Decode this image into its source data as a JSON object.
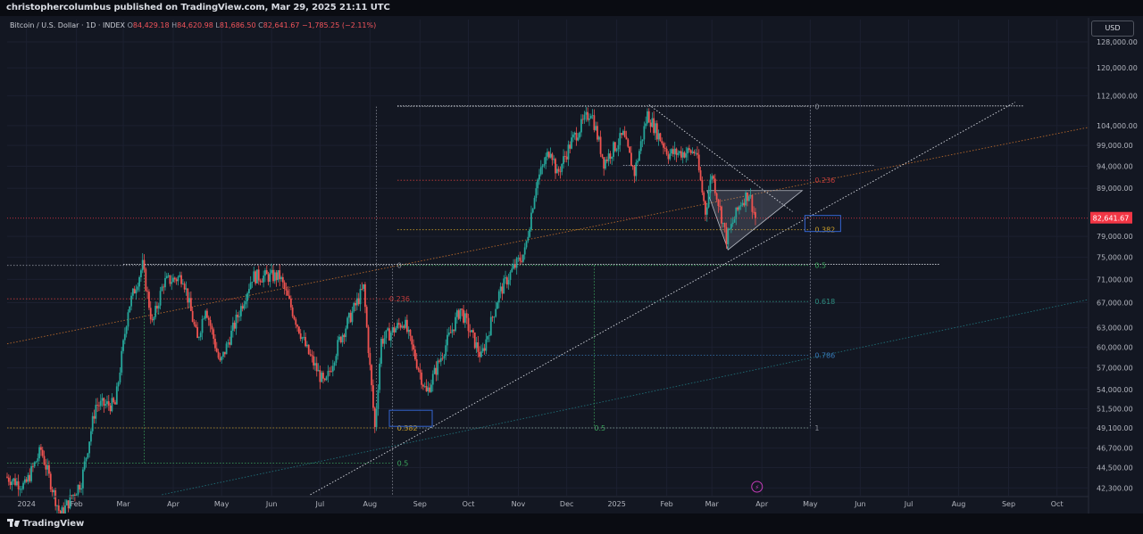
{
  "header": {
    "published": "christophercolumbus published on TradingView.com, Mar 29, 2025 21:11 UTC"
  },
  "legend": {
    "symbol": "Bitcoin / U.S. Dollar · 1D · INDEX",
    "o_label": "O",
    "o_value": "84,429.18",
    "h_label": "H",
    "h_value": "84,620.98",
    "l_label": "L",
    "l_value": "81,686.50",
    "c_label": "C",
    "c_value": "82,641.67",
    "change": "−1,785.25 (−2.11%)"
  },
  "currency_button": "USD",
  "current_price_label": "82,641.67",
  "footer": {
    "brand": "TradingView"
  },
  "colors": {
    "background": "#131722",
    "up": "#26a69a",
    "down": "#ef5350",
    "price_tag": "#f23645"
  },
  "chart_data": {
    "type": "candlestick",
    "title": "",
    "y_scale": "log",
    "ylim": [
      41500,
      130000
    ],
    "y_ticks": [
      128000,
      120000,
      112000,
      104000,
      99000,
      94000,
      89000,
      79000,
      75000,
      71000,
      67000,
      63000,
      60000,
      57000,
      54000,
      51500,
      49100,
      46700,
      44500,
      42300
    ],
    "y_tick_labels": [
      "128,000.00",
      "120,000.00",
      "112,000.00",
      "104,000.00",
      "99,000.00",
      "94,000.00",
      "89,000.00",
      "79,000.00",
      "75,000.00",
      "71,000.00",
      "67,000.00",
      "63,000.00",
      "60,000.00",
      "57,000.00",
      "54,000.00",
      "51,500.00",
      "49,100.00",
      "46,700.00",
      "44,500.00",
      "42,300.00"
    ],
    "x_range": [
      "2023-12-20",
      "2025-10-20"
    ],
    "x_ticks": [
      {
        "date": "2024-01-01",
        "label": "2024"
      },
      {
        "date": "2024-02-01",
        "label": "Feb"
      },
      {
        "date": "2024-03-01",
        "label": "Mar"
      },
      {
        "date": "2024-04-01",
        "label": "Apr"
      },
      {
        "date": "2024-05-01",
        "label": "May"
      },
      {
        "date": "2024-06-01",
        "label": "Jun"
      },
      {
        "date": "2024-07-01",
        "label": "Jul"
      },
      {
        "date": "2024-08-01",
        "label": "Aug"
      },
      {
        "date": "2024-09-01",
        "label": "Sep"
      },
      {
        "date": "2024-10-01",
        "label": "Oct"
      },
      {
        "date": "2024-11-01",
        "label": "Nov"
      },
      {
        "date": "2024-12-01",
        "label": "Dec"
      },
      {
        "date": "2025-01-01",
        "label": "2025"
      },
      {
        "date": "2025-02-01",
        "label": "Feb"
      },
      {
        "date": "2025-03-01",
        "label": "Mar"
      },
      {
        "date": "2025-04-01",
        "label": "Apr"
      },
      {
        "date": "2025-05-01",
        "label": "May"
      },
      {
        "date": "2025-06-01",
        "label": "Jun"
      },
      {
        "date": "2025-07-01",
        "label": "Jul"
      },
      {
        "date": "2025-08-01",
        "label": "Aug"
      },
      {
        "date": "2025-09-01",
        "label": "Sep"
      },
      {
        "date": "2025-10-01",
        "label": "Oct"
      }
    ],
    "price_path": [
      [
        "2023-12-20",
        43500
      ],
      [
        "2024-01-01",
        42500
      ],
      [
        "2024-01-11",
        46500
      ],
      [
        "2024-01-23",
        39500
      ],
      [
        "2024-02-05",
        43000
      ],
      [
        "2024-02-14",
        52000
      ],
      [
        "2024-02-26",
        52000
      ],
      [
        "2024-03-05",
        66000
      ],
      [
        "2024-03-14",
        73500
      ],
      [
        "2024-03-20",
        63500
      ],
      [
        "2024-03-27",
        70500
      ],
      [
        "2024-04-08",
        71500
      ],
      [
        "2024-04-17",
        61000
      ],
      [
        "2024-04-22",
        66500
      ],
      [
        "2024-05-01",
        57500
      ],
      [
        "2024-05-21",
        71500
      ],
      [
        "2024-06-07",
        71500
      ],
      [
        "2024-06-24",
        59500
      ],
      [
        "2024-07-05",
        54500
      ],
      [
        "2024-07-14",
        61000
      ],
      [
        "2024-07-29",
        69500
      ],
      [
        "2024-08-05",
        49100
      ],
      [
        "2024-08-09",
        61000
      ],
      [
        "2024-08-23",
        64000
      ],
      [
        "2024-09-06",
        53500
      ],
      [
        "2024-09-27",
        66000
      ],
      [
        "2024-10-10",
        58500
      ],
      [
        "2024-10-21",
        68500
      ],
      [
        "2024-10-29",
        72500
      ],
      [
        "2024-11-06",
        76000
      ],
      [
        "2024-11-13",
        90000
      ],
      [
        "2024-11-22",
        98500
      ],
      [
        "2024-11-26",
        92000
      ],
      [
        "2024-12-05",
        100000
      ],
      [
        "2024-12-17",
        108000
      ],
      [
        "2024-12-25",
        95000
      ],
      [
        "2025-01-06",
        101500
      ],
      [
        "2025-01-13",
        92500
      ],
      [
        "2025-01-21",
        107000
      ],
      [
        "2025-02-03",
        97000
      ],
      [
        "2025-02-20",
        97500
      ],
      [
        "2025-02-26",
        84000
      ],
      [
        "2025-03-02",
        92500
      ],
      [
        "2025-03-11",
        78500
      ],
      [
        "2025-03-20",
        86000
      ],
      [
        "2025-03-25",
        88000
      ],
      [
        "2025-03-29",
        82641
      ]
    ],
    "fib_left": {
      "range": [
        49100,
        73500
      ],
      "levels": [
        {
          "label": "0",
          "price": 73500
        },
        {
          "label": "0.236",
          "price": 67650
        },
        {
          "label": "0.382",
          "price": 49100
        },
        {
          "label": "0.5",
          "price": 45000
        }
      ]
    },
    "fib_right": {
      "range": [
        49100,
        109000
      ],
      "levels": [
        {
          "label": "0",
          "price": 109000
        },
        {
          "label": "0.236",
          "price": 90800
        },
        {
          "label": "0.382",
          "price": 80300
        },
        {
          "label": "0.5",
          "price": 73500
        },
        {
          "label": "0.618",
          "price": 67200
        },
        {
          "label": "0.786",
          "price": 58800
        },
        {
          "label": "0.5",
          "price": 49100
        },
        {
          "label": "1",
          "price": 49100
        }
      ]
    },
    "annotations": [
      "0.382",
      "0.382"
    ]
  }
}
